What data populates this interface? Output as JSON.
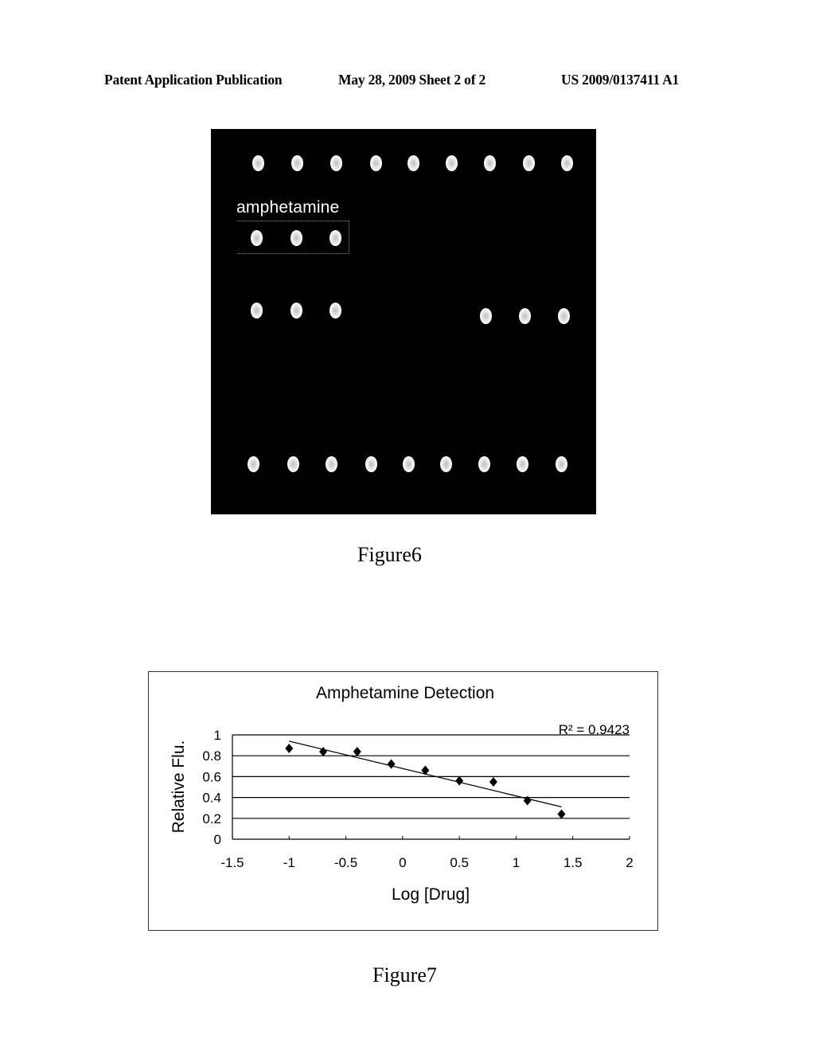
{
  "header": {
    "publication_type": "Patent Application Publication",
    "date_sheet": "May 28, 2009   Sheet 2 of 2",
    "patent_number": "US 2009/0137411 A1"
  },
  "figure6": {
    "caption": "Figure6",
    "label": "amphetamine",
    "description": "Fluorescence microarray image on black background with rows of spots",
    "rows": [
      {
        "name": "top-row",
        "spot_count": 9
      },
      {
        "name": "amphetamine-row",
        "spot_count": 3
      },
      {
        "name": "middle-row-left",
        "spot_count": 3
      },
      {
        "name": "middle-row-right",
        "spot_count": 3
      },
      {
        "name": "bottom-row",
        "spot_count": 9
      }
    ]
  },
  "figure7": {
    "caption": "Figure7"
  },
  "chart_data": {
    "type": "scatter",
    "title": "Amphetamine Detection",
    "xlabel": "Log [Drug]",
    "ylabel": "Relative Flu.",
    "xlim": [
      -1.5,
      2
    ],
    "ylim": [
      0,
      1
    ],
    "x_ticks": [
      "-1.5",
      "-1",
      "-0.5",
      "0",
      "0.5",
      "1",
      "1.5",
      "2"
    ],
    "y_ticks": [
      "0",
      "0.2",
      "0.4",
      "0.6",
      "0.8",
      "1"
    ],
    "grid": "horizontal",
    "marker": "diamond",
    "series": [
      {
        "name": "Relative Flu.",
        "x": [
          -1.0,
          -0.7,
          -0.4,
          -0.1,
          0.2,
          0.5,
          0.8,
          1.1,
          1.4
        ],
        "y": [
          0.87,
          0.84,
          0.84,
          0.72,
          0.66,
          0.56,
          0.55,
          0.37,
          0.24
        ]
      }
    ],
    "trendline": {
      "type": "linear",
      "x": [
        -1.0,
        1.4
      ],
      "y": [
        0.94,
        0.31
      ],
      "r_squared_label": "R² = 0.9423"
    }
  }
}
